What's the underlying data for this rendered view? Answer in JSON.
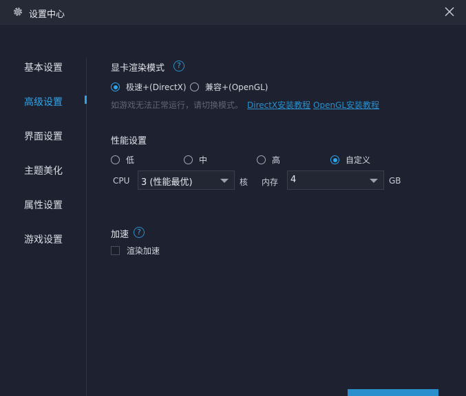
{
  "window": {
    "title": "设置中心",
    "icons": {
      "title": "gear-icon",
      "close": "close-icon"
    }
  },
  "sidebar": {
    "items": [
      {
        "label": "基本设置",
        "active": false
      },
      {
        "label": "高级设置",
        "active": true
      },
      {
        "label": "界面设置",
        "active": false
      },
      {
        "label": "主题美化",
        "active": false
      },
      {
        "label": "属性设置",
        "active": false
      },
      {
        "label": "游戏设置",
        "active": false
      }
    ]
  },
  "render_mode": {
    "title": "显卡渲染模式",
    "help": "?",
    "options": [
      {
        "label": "极速+(DirectX)",
        "checked": true
      },
      {
        "label": "兼容+(OpenGL)",
        "checked": false
      }
    ],
    "hint": "如游戏无法正常运行，请切换模式。",
    "links": [
      "DirectX安装教程",
      "OpenGL安装教程"
    ]
  },
  "performance": {
    "title": "性能设置",
    "options": [
      {
        "label": "低",
        "checked": false
      },
      {
        "label": "中",
        "checked": false
      },
      {
        "label": "高",
        "checked": false
      },
      {
        "label": "自定义",
        "checked": true
      }
    ],
    "cpu_label": "CPU",
    "cpu_value": "3 (性能最优)",
    "cpu_unit": "核",
    "memory_label": "内存",
    "memory_value": "4",
    "memory_unit": "GB"
  },
  "acceleration": {
    "title": "加速",
    "help": "?",
    "checkbox_label": "渲染加速",
    "checked": false
  },
  "colors": {
    "accent": "#2fa4ea",
    "background": "#1e2230",
    "titlebar": "#262a36"
  }
}
